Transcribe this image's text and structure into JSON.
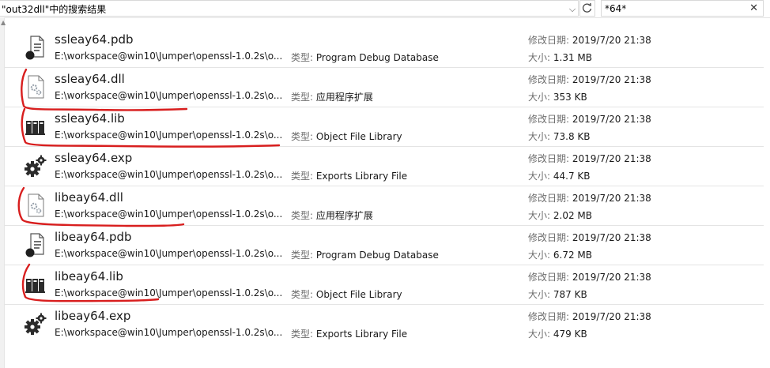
{
  "address_bar": {
    "text": "\"out32dll\"中的搜索结果"
  },
  "search": {
    "value": "*64*",
    "clear_glyph": "✕"
  },
  "labels": {
    "type": "类型:",
    "modified": "修改日期:",
    "size": "大小:"
  },
  "annotation_color": "#d81e1e",
  "files": [
    {
      "name": "ssleay64.pdb",
      "icon": "pdb-file-icon",
      "path": "E:\\workspace@win10\\Jumper\\openssl-1.0.2s\\o...",
      "type": "Program Debug Database",
      "date": "2019/7/20 21:38",
      "size": "1.31 MB"
    },
    {
      "name": "ssleay64.dll",
      "icon": "dll-file-icon",
      "path": "E:\\workspace@win10\\Jumper\\openssl-1.0.2s\\o...",
      "type": "应用程序扩展",
      "date": "2019/7/20 21:38",
      "size": "353 KB"
    },
    {
      "name": "ssleay64.lib",
      "icon": "lib-file-icon",
      "path": "E:\\workspace@win10\\Jumper\\openssl-1.0.2s\\o...",
      "type": "Object File Library",
      "date": "2019/7/20 21:38",
      "size": "73.8 KB"
    },
    {
      "name": "ssleay64.exp",
      "icon": "exp-file-icon",
      "path": "E:\\workspace@win10\\Jumper\\openssl-1.0.2s\\o...",
      "type": "Exports Library File",
      "date": "2019/7/20 21:38",
      "size": "44.7 KB"
    },
    {
      "name": "libeay64.dll",
      "icon": "dll-file-icon",
      "path": "E:\\workspace@win10\\Jumper\\openssl-1.0.2s\\o...",
      "type": "应用程序扩展",
      "date": "2019/7/20 21:38",
      "size": "2.02 MB"
    },
    {
      "name": "libeay64.pdb",
      "icon": "pdb-file-icon",
      "path": "E:\\workspace@win10\\Jumper\\openssl-1.0.2s\\o...",
      "type": "Program Debug Database",
      "date": "2019/7/20 21:38",
      "size": "6.72 MB"
    },
    {
      "name": "libeay64.lib",
      "icon": "lib-file-icon",
      "path": "E:\\workspace@win10\\Jumper\\openssl-1.0.2s\\o...",
      "type": "Object File Library",
      "date": "2019/7/20 21:38",
      "size": "787 KB"
    },
    {
      "name": "libeay64.exp",
      "icon": "exp-file-icon",
      "path": "E:\\workspace@win10\\Jumper\\openssl-1.0.2s\\o...",
      "type": "Exports Library File",
      "date": "2019/7/20 21:38",
      "size": "479 KB"
    }
  ]
}
